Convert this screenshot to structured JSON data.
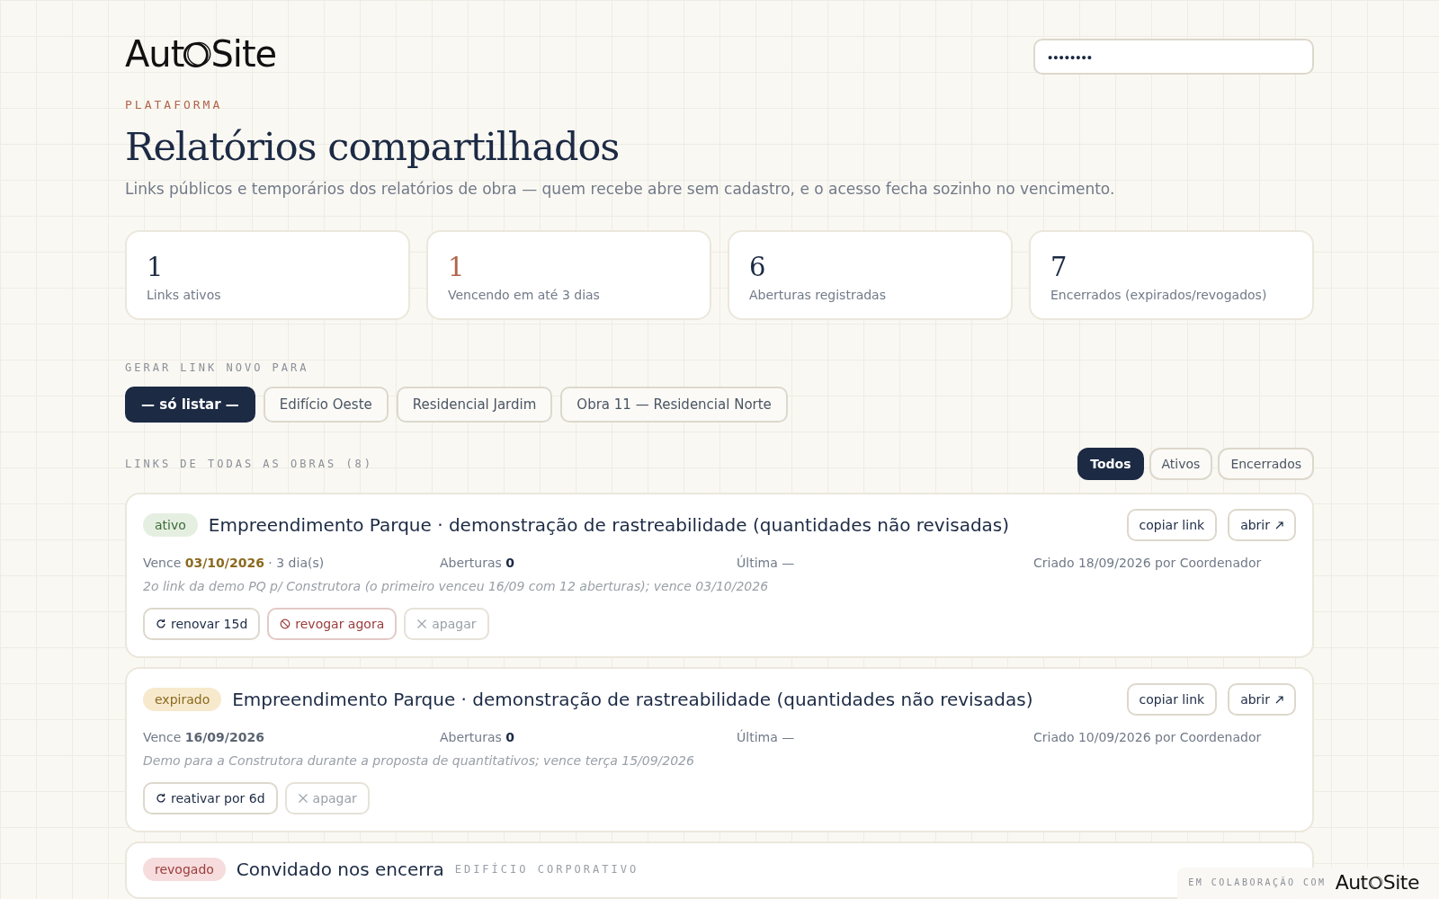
{
  "brand": {
    "before": "Aut",
    "after": "Site"
  },
  "password": {
    "value": "••••••••"
  },
  "eyebrow": "PLATAFORMA",
  "title": "Relatórios compartilhados",
  "subtitle": "Links públicos e temporários dos relatórios de obra — quem recebe abre sem cadastro, e o acesso fecha sozinho no vencimento.",
  "stats": [
    {
      "value": "1",
      "label": "Links ativos",
      "kind": "normal"
    },
    {
      "value": "1",
      "label": "Vencendo em até 3 dias",
      "kind": "warning"
    },
    {
      "value": "6",
      "label": "Aberturas registradas",
      "kind": "normal"
    },
    {
      "value": "7",
      "label": "Encerrados (expirados/revogados)",
      "kind": "normal"
    }
  ],
  "generate": {
    "label": "GERAR LINK NOVO PARA",
    "options": [
      {
        "label": "— só listar —",
        "selected": true
      },
      {
        "label": "Edifício Oeste",
        "selected": false
      },
      {
        "label": "Residencial Jardim",
        "selected": false
      },
      {
        "label": "Obra 11 — Residencial Norte",
        "selected": false
      }
    ]
  },
  "links": {
    "label": "LINKS DE TODAS AS OBRAS (8)",
    "filters": [
      {
        "label": "Todos",
        "selected": true
      },
      {
        "label": "Ativos",
        "selected": false
      },
      {
        "label": "Encerrados",
        "selected": false
      }
    ],
    "items": [
      {
        "status": "ativo",
        "kind": "active",
        "title": "Empreendimento Parque · demonstração de rastreabilidade (quantidades não revisadas)",
        "expires_label": "Vence",
        "expires": "03/10/2026",
        "expires_note": "· 3 dia(s)",
        "opens_label": "Aberturas",
        "opens": "0",
        "last": "Última —",
        "created": "Criado 18/09/2026 por Coordenador",
        "note": "2o link da demo PQ p/ Construtora (o primeiro venceu 16/09 com 12 aberturas); vence 03/10/2026",
        "copy": "copiar link",
        "open": "abrir",
        "actions": [
          {
            "label": "renovar 15d",
            "kind": "renew"
          },
          {
            "label": "revogar agora",
            "kind": "revoke"
          },
          {
            "label": "apagar",
            "kind": "delete"
          }
        ]
      },
      {
        "status": "expirado",
        "kind": "expired",
        "title": "Empreendimento Parque · demonstração de rastreabilidade (quantidades não revisadas)",
        "expires_label": "Vence",
        "expires": "16/09/2026",
        "opens_label": "Aberturas",
        "opens": "0",
        "last": "Última —",
        "created": "Criado 10/09/2026 por Coordenador",
        "note": "Demo para a Construtora durante a proposta de quantitativos; vence terça 15/09/2026",
        "copy": "copiar link",
        "open": "abrir",
        "actions": [
          {
            "label": "reativar por 6d",
            "kind": "renew"
          },
          {
            "label": "apagar",
            "kind": "delete"
          }
        ]
      },
      {
        "status": "revogado",
        "kind": "revoked",
        "title": "Convidado nos encerra",
        "project": "EDIFÍCIO CORPORATIVO"
      }
    ]
  },
  "credit": {
    "label": "EM COLABORAÇÃO COM",
    "before": "Aut",
    "after": "Site"
  }
}
